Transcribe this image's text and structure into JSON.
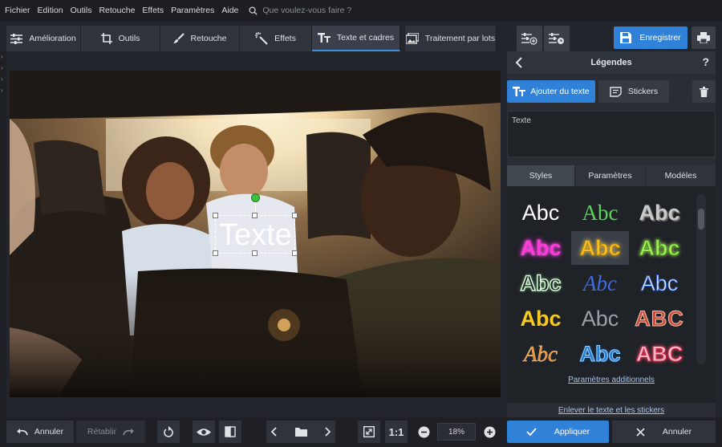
{
  "menu": [
    "Fichier",
    "Edition",
    "Outils",
    "Retouche",
    "Effets",
    "Paramètres",
    "Aide"
  ],
  "search": {
    "placeholder": "Que voulez-vous faire ?"
  },
  "toolbar": {
    "tabs": [
      {
        "label": "Amélioration",
        "icon": "sliders-icon"
      },
      {
        "label": "Outils",
        "icon": "crop-icon"
      },
      {
        "label": "Retouche",
        "icon": "brush-icon"
      },
      {
        "label": "Effets",
        "icon": "magic-wand-icon"
      },
      {
        "label": "Texte et cadres",
        "icon": "text-icon"
      },
      {
        "label": "Traitement par lots",
        "icon": "images-icon"
      }
    ],
    "active_tab": "Texte et cadres",
    "save_label": "Enregistrer"
  },
  "canvas": {
    "overlay_text": "Texte"
  },
  "panel": {
    "title": "Légendes",
    "help": "?",
    "add_text_label": "Ajouter du texte",
    "stickers_label": "Stickers",
    "text_value": "Texte",
    "tabs": [
      "Styles",
      "Paramètres",
      "Modèles"
    ],
    "active_tab": "Styles",
    "styles": [
      "Abc",
      "Abc",
      "Abc",
      "Abc",
      "Abc",
      "Abc",
      "Abc",
      "Abc",
      "Abc",
      "Abc",
      "Abc",
      "ABC",
      "Abc",
      "Abc",
      "ABC"
    ],
    "additional_link": "Paramètres additionnels",
    "remove_link": "Enlever le texte et les stickers"
  },
  "bottom": {
    "undo_label": "Annuler",
    "redo_label": "Rétablir",
    "one_to_one": "1:1",
    "zoom": "18%",
    "apply_label": "Appliquer",
    "cancel_label": "Annuler"
  },
  "colors": {
    "accent": "#2f82d8",
    "background": "#22252b",
    "panel": "#2a2d34"
  }
}
